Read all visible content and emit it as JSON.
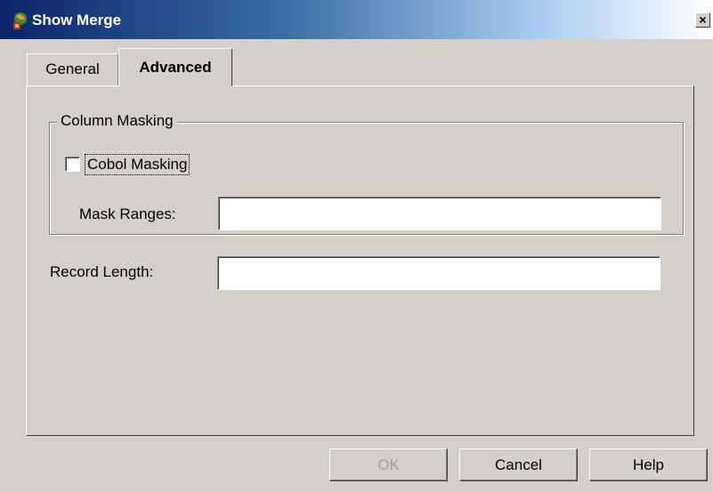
{
  "window": {
    "title": "Show Merge",
    "icon": "app-globe-icon",
    "close_glyph": "×"
  },
  "tabs": [
    {
      "label": "General",
      "selected": false
    },
    {
      "label": "Advanced",
      "selected": true
    }
  ],
  "column_masking": {
    "legend": "Column Masking",
    "cobol_masking": {
      "label": "Cobol Masking",
      "checked": false
    },
    "mask_ranges": {
      "label": "Mask Ranges:",
      "value": ""
    }
  },
  "record_length": {
    "label": "Record Length:",
    "value": ""
  },
  "buttons": {
    "ok": "OK",
    "cancel": "Cancel",
    "help": "Help"
  },
  "colors": {
    "titlebar_start": "#0a246a",
    "titlebar_end": "#ffffff",
    "face": "#d4d0c8",
    "disabled_text": "#a0a0a0"
  }
}
